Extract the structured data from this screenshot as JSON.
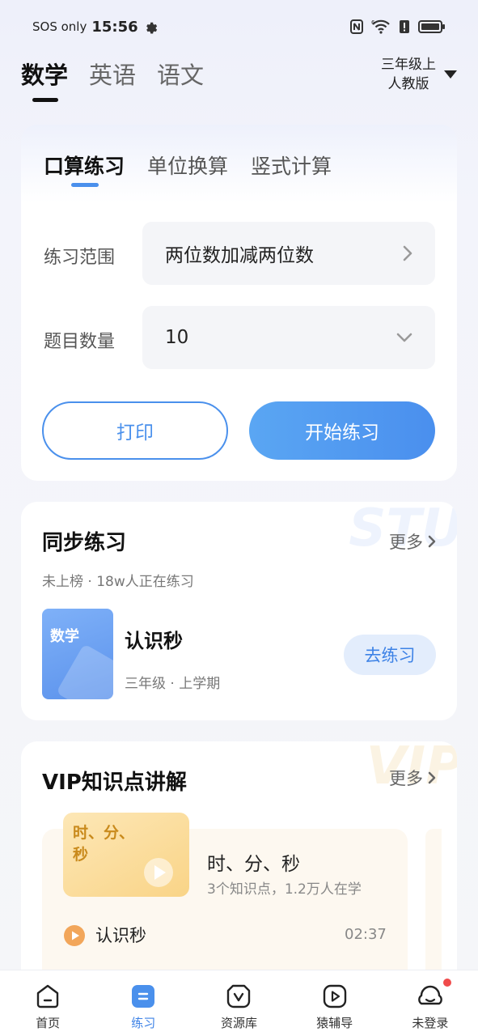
{
  "status_bar": {
    "sos": "SOS only",
    "time": "15:56",
    "wifi_sup": "6"
  },
  "subjects": {
    "items": [
      "数学",
      "英语",
      "语文"
    ],
    "active": "数学"
  },
  "grade_picker": {
    "grade": "三年级上",
    "edition": "人教版"
  },
  "calc_card": {
    "tabs": [
      "口算练习",
      "单位换算",
      "竖式计算"
    ],
    "range_label": "练习范围",
    "range_value": "两位数加减两位数",
    "count_label": "题目数量",
    "count_value": "10",
    "print_label": "打印",
    "start_label": "开始练习"
  },
  "sync_card": {
    "title": "同步练习",
    "more": "更多",
    "watermark": "STU",
    "subtitle": "未上榜 · 18w人正在练习",
    "cover_label": "数学",
    "lesson_title": "认识秒",
    "lesson_meta": "三年级 · 上学期",
    "practice_button": "去练习"
  },
  "vip_card": {
    "title": "VIP知识点讲解",
    "more": "更多",
    "watermark": "VIP",
    "thumb_text": "时、分、秒",
    "course_title": "时、分、秒",
    "course_meta": "3个知识点，1.2万人在学",
    "item_title": "认识秒",
    "item_duration": "02:37"
  },
  "bottom_nav": {
    "items": [
      {
        "label": "首页",
        "icon": "home-icon"
      },
      {
        "label": "练习",
        "icon": "practice-icon"
      },
      {
        "label": "资源库",
        "icon": "resource-icon"
      },
      {
        "label": "猿辅导",
        "icon": "video-play-icon"
      },
      {
        "label": "未登录",
        "icon": "profile-icon"
      }
    ],
    "active": "练习"
  },
  "colors": {
    "accent": "#4a90ec",
    "badge": "#f04b4b",
    "vip_gold": "#c98a1c"
  }
}
